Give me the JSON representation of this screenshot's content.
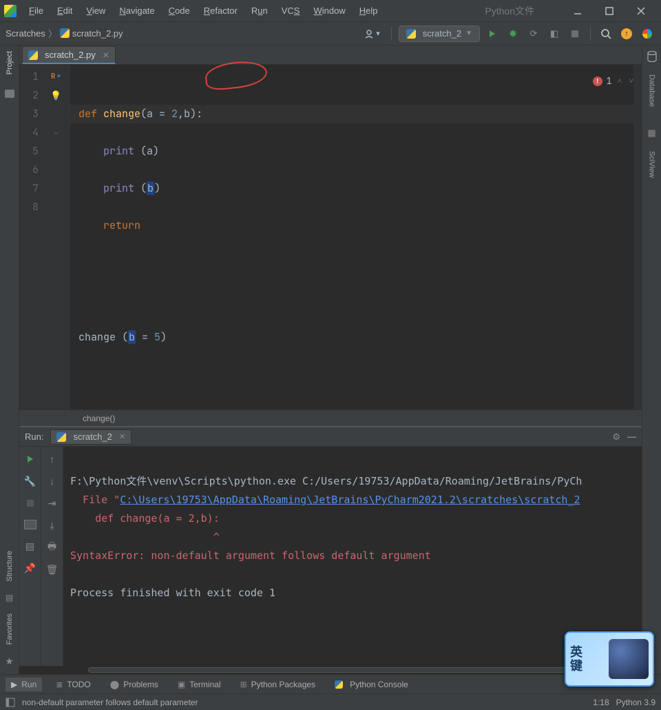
{
  "titlebar": {
    "menus": [
      "File",
      "Edit",
      "View",
      "Navigate",
      "Code",
      "Refactor",
      "Run",
      "VCS",
      "Window",
      "Help"
    ],
    "extra": "Python文件"
  },
  "breadcrumb": {
    "root": "Scratches",
    "file": "scratch_2.py"
  },
  "runconfig": {
    "name": "scratch_2"
  },
  "file_tab": {
    "name": "scratch_2.py"
  },
  "editor": {
    "line_count": 8,
    "lines": {
      "l1_def": "def ",
      "l1_fn": "change",
      "l1_open": "(a = ",
      "l1_num": "2",
      "l1_rest": ",b):",
      "l2_print": "print ",
      "l2_arg": "(a)",
      "l3_print": "print ",
      "l3_open": "(",
      "l3_b": "b",
      "l3_close": ")",
      "l4": "return",
      "l7_call": "change (",
      "l7_b": "b",
      "l7_rest": " = ",
      "l7_num": "5",
      "l7_close": ")"
    },
    "breadcrumb_fn": "change()",
    "error_count": "1"
  },
  "run": {
    "label": "Run:",
    "tab": "scratch_2",
    "console": {
      "cmd": "F:\\Python文件\\venv\\Scripts\\python.exe C:/Users/19753/AppData/Roaming/JetBrains/PyCh",
      "file_prefix": "  File ",
      "file_quote": "\"",
      "file_link": "C:\\Users\\19753\\AppData\\Roaming\\JetBrains\\PyCharm2021.2\\scratches\\scratch_2",
      "def_line": "    def change(a = 2,b):",
      "caret_line": "                       ^",
      "error_line": "SyntaxError: non-default argument follows default argument",
      "exit_line": "Process finished with exit code 1"
    }
  },
  "bottom_tabs": {
    "run": "Run",
    "todo": "TODO",
    "problems": "Problems",
    "terminal": "Terminal",
    "packages": "Python Packages",
    "console": "Python Console"
  },
  "left_labels": {
    "project": "Project",
    "structure": "Structure",
    "favorites": "Favorites"
  },
  "right_labels": {
    "database": "Database",
    "sciview": "SciView"
  },
  "status": {
    "msg": "non-default parameter follows default parameter",
    "pos": "1:18",
    "interp": "Python 3.9"
  },
  "ime": {
    "ch1": "英",
    "ch2": "键"
  }
}
